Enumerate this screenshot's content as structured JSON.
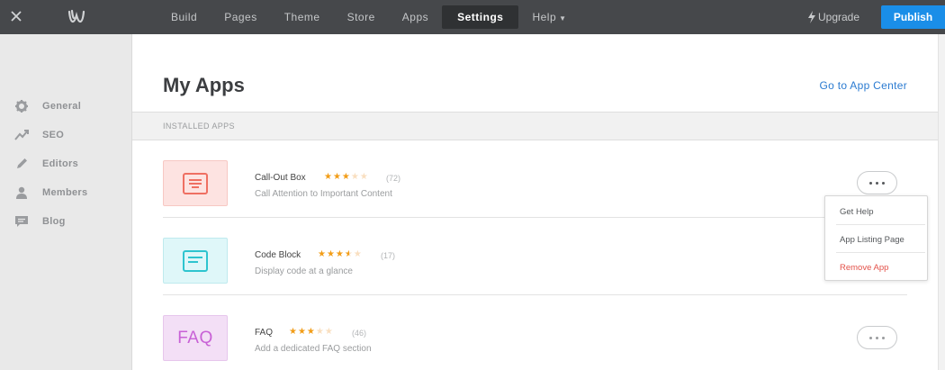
{
  "topbar": {
    "nav": [
      "Build",
      "Pages",
      "Theme",
      "Store",
      "Apps",
      "Settings",
      "Help"
    ],
    "active": "Settings",
    "upgrade_label": "Upgrade",
    "publish_label": "Publish",
    "colors": {
      "bar": "#46484b",
      "publish": "#1a8ee8"
    }
  },
  "sidebar": {
    "items": [
      {
        "label": "General",
        "icon": "gear-icon"
      },
      {
        "label": "SEO",
        "icon": "trend-icon"
      },
      {
        "label": "Editors",
        "icon": "pencil-icon"
      },
      {
        "label": "Members",
        "icon": "person-icon"
      },
      {
        "label": "Blog",
        "icon": "comment-icon"
      }
    ]
  },
  "main": {
    "title": "My Apps",
    "app_center_link": "Go to App Center",
    "section_label": "INSTALLED APPS",
    "apps": [
      {
        "name": "Call-Out Box",
        "description": "Call Attention to Important Content",
        "rating": 3,
        "rating_count": "(72)",
        "thumb_color": "#fde3e1"
      },
      {
        "name": "Code Block",
        "description": "Display code at a glance",
        "rating": 3.5,
        "rating_count": "(17)",
        "thumb_color": "#dff7f9"
      },
      {
        "name": "FAQ",
        "description": "Add a dedicated FAQ section",
        "rating": 3,
        "rating_count": "(46)",
        "thumb_label": "FAQ",
        "thumb_color": "#f3dff6"
      }
    ]
  },
  "dropdown": {
    "items": [
      "Get Help",
      "App Listing Page",
      "Remove App"
    ]
  }
}
